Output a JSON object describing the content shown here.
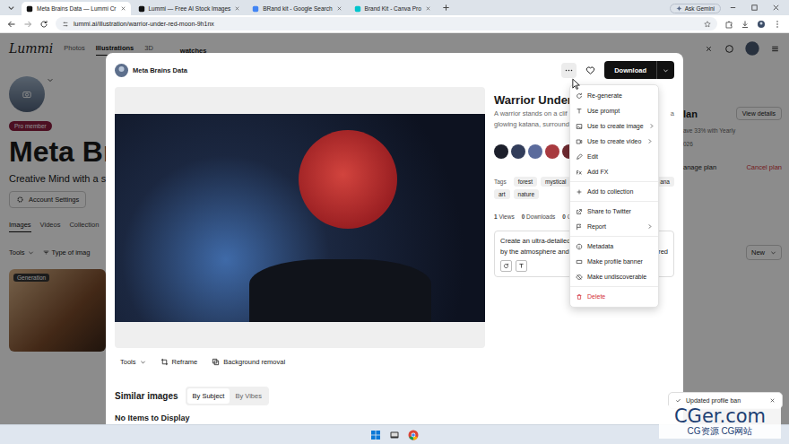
{
  "browser": {
    "tabs": [
      {
        "label": "Meta Brains Data — Lummi Cr",
        "selected": true
      },
      {
        "label": "Lummi — Free AI Stock Images",
        "selected": false
      },
      {
        "label": "BRand kit - Google Search",
        "selected": false
      },
      {
        "label": "Brand Kit - Canva Pro",
        "selected": false
      }
    ],
    "gemini": "Ask Gemini",
    "url": "lummi.ai/illustration/warrior-under-red-moon-9h1nx"
  },
  "page": {
    "logo": "Lummi",
    "nav": [
      {
        "label": "Photos",
        "selected": false
      },
      {
        "label": "Illustrations",
        "selected": true
      },
      {
        "label": "3D",
        "selected": false
      }
    ],
    "search": "watches",
    "badge": "Pro member",
    "name": "Meta Br",
    "bio": "Creative Mind with a si",
    "account_settings": "Account Settings",
    "tabs": [
      {
        "label": "Images",
        "selected": true
      },
      {
        "label": "Videos",
        "selected": false
      },
      {
        "label": "Collection",
        "selected": false
      }
    ],
    "tools": "Tools",
    "type_filter": "Type of imag",
    "card_label": "Generation",
    "plan_title": "lan",
    "view_details": "View details",
    "plan_note": "ave 33% with Yearly",
    "plan_date": "026",
    "manage": "anage plan",
    "cancel": "Cancel plan",
    "sort": "New"
  },
  "modal": {
    "author": "Meta Brains Data",
    "download": "Download",
    "title": "Warrior Under",
    "description": [
      {
        "text": "A warrior stands on a clif",
        "tail": "a"
      },
      {
        "text": "glowing katana, surround",
        "tail": ""
      }
    ],
    "swatches": [
      {
        "color": "#1c1f2b"
      },
      {
        "color": "#323d5a"
      },
      {
        "color": "#5b6b9c"
      },
      {
        "color": "#a83a3f"
      },
      {
        "color": "#6e2a30"
      }
    ],
    "tags_label": "Tags",
    "tag_rows": [
      [
        {
          "label": "forest"
        },
        {
          "label": "mystical"
        },
        {
          "label": "ana"
        }
      ],
      [
        {
          "label": "art"
        },
        {
          "label": "nature"
        }
      ]
    ],
    "stats": [
      {
        "count": "1",
        "label": "Views"
      },
      {
        "count": "0",
        "label": "Downloads"
      },
      {
        "count": "0",
        "label": "C"
      }
    ],
    "prompt": [
      {
        "text": "Create an ultra-detailed",
        "tail": ""
      },
      {
        "text": "by the atmosphere and",
        "tail": "red"
      }
    ],
    "tools": [
      {
        "label": "Tools"
      },
      {
        "label": "Reframe"
      },
      {
        "label": "Background removal"
      }
    ],
    "similar_title": "Similar images",
    "similar_toggle": [
      {
        "label": "By Subject",
        "selected": true
      },
      {
        "label": "By Vibes",
        "selected": false
      }
    ],
    "empty": "No Items to Display"
  },
  "menu": {
    "groups": [
      [
        {
          "label": "Re-generate",
          "submenu": false,
          "danger": false
        },
        {
          "label": "Use prompt",
          "submenu": false,
          "danger": false
        },
        {
          "label": "Use to create image",
          "submenu": true,
          "danger": false
        },
        {
          "label": "Use to create video",
          "submenu": true,
          "danger": false
        },
        {
          "label": "Edit",
          "submenu": false,
          "danger": false
        },
        {
          "label": "Add FX",
          "submenu": false,
          "danger": false
        }
      ],
      [
        {
          "label": "Add to collection",
          "submenu": false,
          "danger": false
        }
      ],
      [
        {
          "label": "Share to Twitter",
          "submenu": false,
          "danger": false
        },
        {
          "label": "Report",
          "submenu": true,
          "danger": false
        }
      ],
      [
        {
          "label": "Metadata",
          "submenu": false,
          "danger": false
        },
        {
          "label": "Make profile banner",
          "submenu": false,
          "danger": false
        },
        {
          "label": "Make undiscoverable",
          "submenu": false,
          "danger": false
        }
      ],
      [
        {
          "label": "Delete",
          "submenu": false,
          "danger": true
        }
      ]
    ]
  },
  "toast": {
    "text": "Updated profile ban"
  },
  "watermark": {
    "title": "CGer.com",
    "subtitle": "CG资源 CG网站"
  }
}
